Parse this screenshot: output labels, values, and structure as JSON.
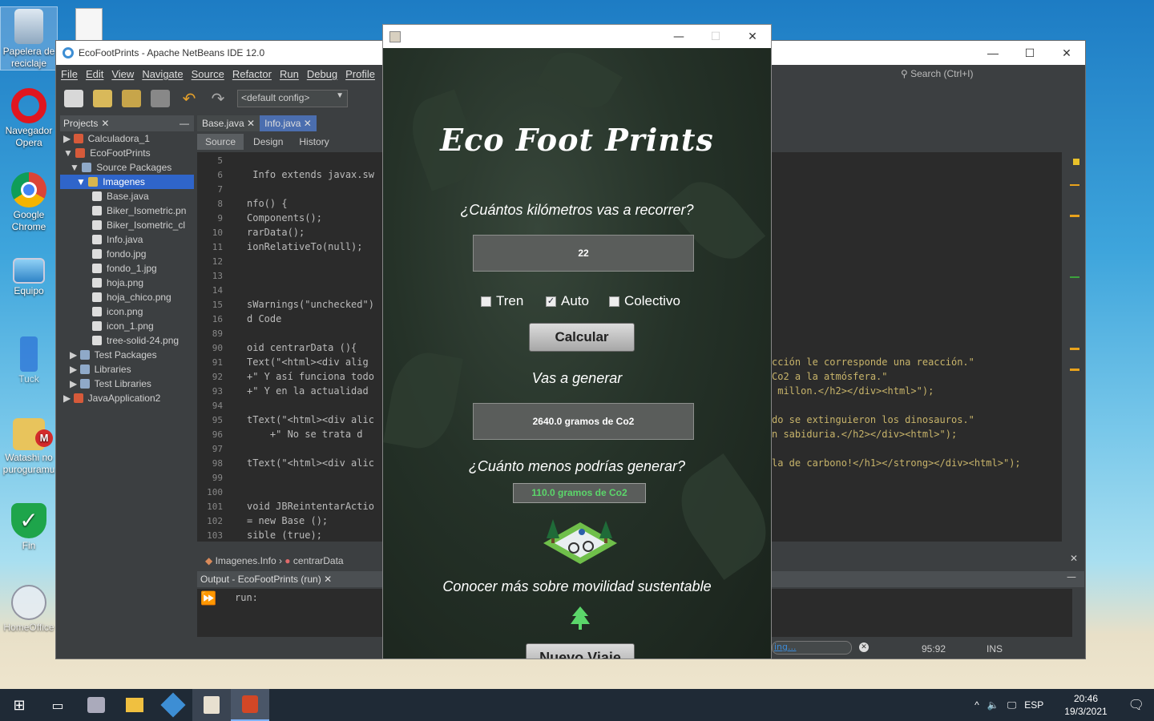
{
  "desktop": {
    "icons": [
      {
        "label": "Papelera de reciclaje",
        "icon": "recycle-bin-icon"
      },
      {
        "label": "Navegador Opera",
        "icon": "opera-icon"
      },
      {
        "label": "Google Chrome",
        "icon": "chrome-icon"
      },
      {
        "label": "Equipo",
        "icon": "computer-icon"
      },
      {
        "label": "Tuck",
        "icon": "phone-icon"
      },
      {
        "label": "Watashi no puroguramu",
        "icon": "folder-icon"
      },
      {
        "label": "Fin",
        "icon": "shield-check-icon"
      },
      {
        "label": "HomeOffice",
        "icon": "clock-icon"
      }
    ]
  },
  "netbeans": {
    "title": "EcoFootPrints - Apache NetBeans IDE 12.0",
    "menu": [
      "File",
      "Edit",
      "View",
      "Navigate",
      "Source",
      "Refactor",
      "Run",
      "Debug",
      "Profile"
    ],
    "config": "<default config>",
    "search_placeholder": "Search (Ctrl+I)",
    "projects_tab": "Projects",
    "tree": [
      {
        "label": "Calculadora_1",
        "depth": 0
      },
      {
        "label": "EcoFootPrints",
        "depth": 0
      },
      {
        "label": "Source Packages",
        "depth": 1
      },
      {
        "label": "Imagenes",
        "depth": 2,
        "selected": true
      },
      {
        "label": "Base.java",
        "depth": 3
      },
      {
        "label": "Biker_Isometric.pn",
        "depth": 3
      },
      {
        "label": "Biker_Isometric_cl",
        "depth": 3
      },
      {
        "label": "Info.java",
        "depth": 3
      },
      {
        "label": "fondo.jpg",
        "depth": 3
      },
      {
        "label": "fondo_1.jpg",
        "depth": 3
      },
      {
        "label": "hoja.png",
        "depth": 3
      },
      {
        "label": "hoja_chico.png",
        "depth": 3
      },
      {
        "label": "icon.png",
        "depth": 3
      },
      {
        "label": "icon_1.png",
        "depth": 3
      },
      {
        "label": "tree-solid-24.png",
        "depth": 3
      },
      {
        "label": "Test Packages",
        "depth": 1
      },
      {
        "label": "Libraries",
        "depth": 1
      },
      {
        "label": "Test Libraries",
        "depth": 1
      },
      {
        "label": "JavaApplication2",
        "depth": 0
      }
    ],
    "editor_tabs": [
      "Base.java",
      "Info.java"
    ],
    "view_tabs": [
      "Source",
      "Design",
      "History"
    ],
    "line_numbers": [
      "5",
      "6",
      "7",
      "8",
      "9",
      "10",
      "11",
      "12",
      "13",
      "14",
      "15",
      "16",
      "89",
      "90",
      "91",
      "92",
      "93",
      "94",
      "95",
      "96",
      "97",
      "98",
      "99",
      "100",
      "101",
      "102",
      "103"
    ],
    "code_left": [
      "",
      " Info extends javax.sw",
      "",
      "nfo() {",
      "Components();",
      "rarData();",
      "ionRelativeTo(null);",
      "",
      "",
      "",
      "sWarnings(\"unchecked\")",
      "d Code",
      "",
      "oid centrarData (){",
      "Text(\"<html><div alig",
      "+\" Y así funciona todo",
      "+\" Y en la actualidad",
      "",
      "tText(\"<html><div alic",
      "    +\" No se trata d",
      "",
      "tText(\"<html><div alic",
      "",
      "",
      "void JBReintentarActio",
      "= new Base ();",
      "sible (true);"
    ],
    "code_right": [
      {
        "row": 14,
        "text": "cción le corresponde una reacción.\""
      },
      {
        "row": 15,
        "text": "Co2 a la atmósfera.\""
      },
      {
        "row": 16,
        "text": " millon.</h2></div><html>\");"
      },
      {
        "row": 18,
        "text": "do se extinguieron los dinosauros.\""
      },
      {
        "row": 19,
        "text": "n sabiduria.</h2></div><html>\");"
      },
      {
        "row": 21,
        "text": "la de carbono!</h1></strong></div><html>\");"
      }
    ],
    "breadcrumb": [
      "Imagenes.Info",
      "centrarData"
    ],
    "output_tab": "Output - EcoFootPrints (run)",
    "output_text": "run:",
    "status_search": "ing...",
    "position": "95:92",
    "mode": "INS"
  },
  "app": {
    "title_text": "Eco Foot Prints",
    "question_km": "¿Cuántos kilómetros vas a recorrer?",
    "km_value": "22",
    "options": [
      {
        "label": "Tren",
        "checked": false
      },
      {
        "label": "Auto",
        "checked": true
      },
      {
        "label": "Colectivo",
        "checked": false
      }
    ],
    "calc_button": "Calcular",
    "generate_label": "Vas a generar",
    "result_value": "2640.0 gramos de Co2",
    "less_question": "¿Cuánto menos podrías generar?",
    "less_value": "110.0 gramos de Co2",
    "more_info": "Conocer más sobre movilidad sustentable",
    "new_trip_button": "Nuevo Viaje",
    "accent_green": "#5bd66a"
  },
  "taskbar": {
    "lang": "ESP",
    "time": "20:46",
    "date": "19/3/2021"
  }
}
